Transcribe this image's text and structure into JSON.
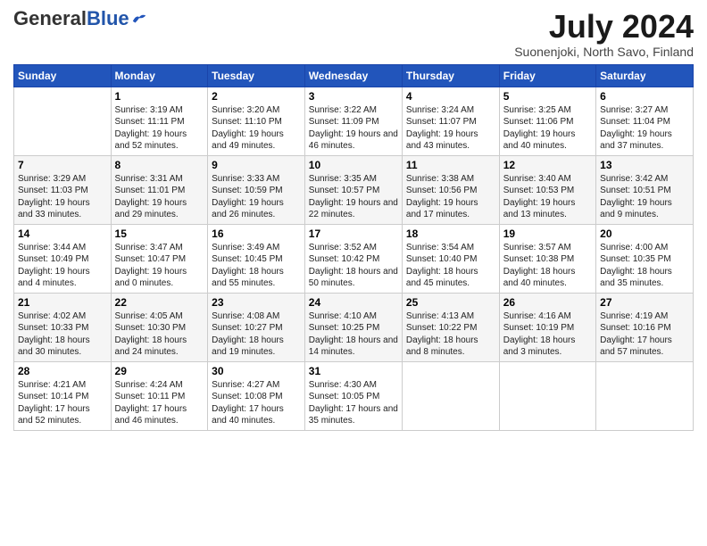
{
  "header": {
    "logo_general": "General",
    "logo_blue": "Blue",
    "month_title": "July 2024",
    "subtitle": "Suonenjoki, North Savo, Finland"
  },
  "days_of_week": [
    "Sunday",
    "Monday",
    "Tuesday",
    "Wednesday",
    "Thursday",
    "Friday",
    "Saturday"
  ],
  "weeks": [
    [
      {
        "day": "",
        "sunrise": "",
        "sunset": "",
        "daylight": ""
      },
      {
        "day": "1",
        "sunrise": "Sunrise: 3:19 AM",
        "sunset": "Sunset: 11:11 PM",
        "daylight": "Daylight: 19 hours and 52 minutes."
      },
      {
        "day": "2",
        "sunrise": "Sunrise: 3:20 AM",
        "sunset": "Sunset: 11:10 PM",
        "daylight": "Daylight: 19 hours and 49 minutes."
      },
      {
        "day": "3",
        "sunrise": "Sunrise: 3:22 AM",
        "sunset": "Sunset: 11:09 PM",
        "daylight": "Daylight: 19 hours and 46 minutes."
      },
      {
        "day": "4",
        "sunrise": "Sunrise: 3:24 AM",
        "sunset": "Sunset: 11:07 PM",
        "daylight": "Daylight: 19 hours and 43 minutes."
      },
      {
        "day": "5",
        "sunrise": "Sunrise: 3:25 AM",
        "sunset": "Sunset: 11:06 PM",
        "daylight": "Daylight: 19 hours and 40 minutes."
      },
      {
        "day": "6",
        "sunrise": "Sunrise: 3:27 AM",
        "sunset": "Sunset: 11:04 PM",
        "daylight": "Daylight: 19 hours and 37 minutes."
      }
    ],
    [
      {
        "day": "7",
        "sunrise": "Sunrise: 3:29 AM",
        "sunset": "Sunset: 11:03 PM",
        "daylight": "Daylight: 19 hours and 33 minutes."
      },
      {
        "day": "8",
        "sunrise": "Sunrise: 3:31 AM",
        "sunset": "Sunset: 11:01 PM",
        "daylight": "Daylight: 19 hours and 29 minutes."
      },
      {
        "day": "9",
        "sunrise": "Sunrise: 3:33 AM",
        "sunset": "Sunset: 10:59 PM",
        "daylight": "Daylight: 19 hours and 26 minutes."
      },
      {
        "day": "10",
        "sunrise": "Sunrise: 3:35 AM",
        "sunset": "Sunset: 10:57 PM",
        "daylight": "Daylight: 19 hours and 22 minutes."
      },
      {
        "day": "11",
        "sunrise": "Sunrise: 3:38 AM",
        "sunset": "Sunset: 10:56 PM",
        "daylight": "Daylight: 19 hours and 17 minutes."
      },
      {
        "day": "12",
        "sunrise": "Sunrise: 3:40 AM",
        "sunset": "Sunset: 10:53 PM",
        "daylight": "Daylight: 19 hours and 13 minutes."
      },
      {
        "day": "13",
        "sunrise": "Sunrise: 3:42 AM",
        "sunset": "Sunset: 10:51 PM",
        "daylight": "Daylight: 19 hours and 9 minutes."
      }
    ],
    [
      {
        "day": "14",
        "sunrise": "Sunrise: 3:44 AM",
        "sunset": "Sunset: 10:49 PM",
        "daylight": "Daylight: 19 hours and 4 minutes."
      },
      {
        "day": "15",
        "sunrise": "Sunrise: 3:47 AM",
        "sunset": "Sunset: 10:47 PM",
        "daylight": "Daylight: 19 hours and 0 minutes."
      },
      {
        "day": "16",
        "sunrise": "Sunrise: 3:49 AM",
        "sunset": "Sunset: 10:45 PM",
        "daylight": "Daylight: 18 hours and 55 minutes."
      },
      {
        "day": "17",
        "sunrise": "Sunrise: 3:52 AM",
        "sunset": "Sunset: 10:42 PM",
        "daylight": "Daylight: 18 hours and 50 minutes."
      },
      {
        "day": "18",
        "sunrise": "Sunrise: 3:54 AM",
        "sunset": "Sunset: 10:40 PM",
        "daylight": "Daylight: 18 hours and 45 minutes."
      },
      {
        "day": "19",
        "sunrise": "Sunrise: 3:57 AM",
        "sunset": "Sunset: 10:38 PM",
        "daylight": "Daylight: 18 hours and 40 minutes."
      },
      {
        "day": "20",
        "sunrise": "Sunrise: 4:00 AM",
        "sunset": "Sunset: 10:35 PM",
        "daylight": "Daylight: 18 hours and 35 minutes."
      }
    ],
    [
      {
        "day": "21",
        "sunrise": "Sunrise: 4:02 AM",
        "sunset": "Sunset: 10:33 PM",
        "daylight": "Daylight: 18 hours and 30 minutes."
      },
      {
        "day": "22",
        "sunrise": "Sunrise: 4:05 AM",
        "sunset": "Sunset: 10:30 PM",
        "daylight": "Daylight: 18 hours and 24 minutes."
      },
      {
        "day": "23",
        "sunrise": "Sunrise: 4:08 AM",
        "sunset": "Sunset: 10:27 PM",
        "daylight": "Daylight: 18 hours and 19 minutes."
      },
      {
        "day": "24",
        "sunrise": "Sunrise: 4:10 AM",
        "sunset": "Sunset: 10:25 PM",
        "daylight": "Daylight: 18 hours and 14 minutes."
      },
      {
        "day": "25",
        "sunrise": "Sunrise: 4:13 AM",
        "sunset": "Sunset: 10:22 PM",
        "daylight": "Daylight: 18 hours and 8 minutes."
      },
      {
        "day": "26",
        "sunrise": "Sunrise: 4:16 AM",
        "sunset": "Sunset: 10:19 PM",
        "daylight": "Daylight: 18 hours and 3 minutes."
      },
      {
        "day": "27",
        "sunrise": "Sunrise: 4:19 AM",
        "sunset": "Sunset: 10:16 PM",
        "daylight": "Daylight: 17 hours and 57 minutes."
      }
    ],
    [
      {
        "day": "28",
        "sunrise": "Sunrise: 4:21 AM",
        "sunset": "Sunset: 10:14 PM",
        "daylight": "Daylight: 17 hours and 52 minutes."
      },
      {
        "day": "29",
        "sunrise": "Sunrise: 4:24 AM",
        "sunset": "Sunset: 10:11 PM",
        "daylight": "Daylight: 17 hours and 46 minutes."
      },
      {
        "day": "30",
        "sunrise": "Sunrise: 4:27 AM",
        "sunset": "Sunset: 10:08 PM",
        "daylight": "Daylight: 17 hours and 40 minutes."
      },
      {
        "day": "31",
        "sunrise": "Sunrise: 4:30 AM",
        "sunset": "Sunset: 10:05 PM",
        "daylight": "Daylight: 17 hours and 35 minutes."
      },
      {
        "day": "",
        "sunrise": "",
        "sunset": "",
        "daylight": ""
      },
      {
        "day": "",
        "sunrise": "",
        "sunset": "",
        "daylight": ""
      },
      {
        "day": "",
        "sunrise": "",
        "sunset": "",
        "daylight": ""
      }
    ]
  ]
}
